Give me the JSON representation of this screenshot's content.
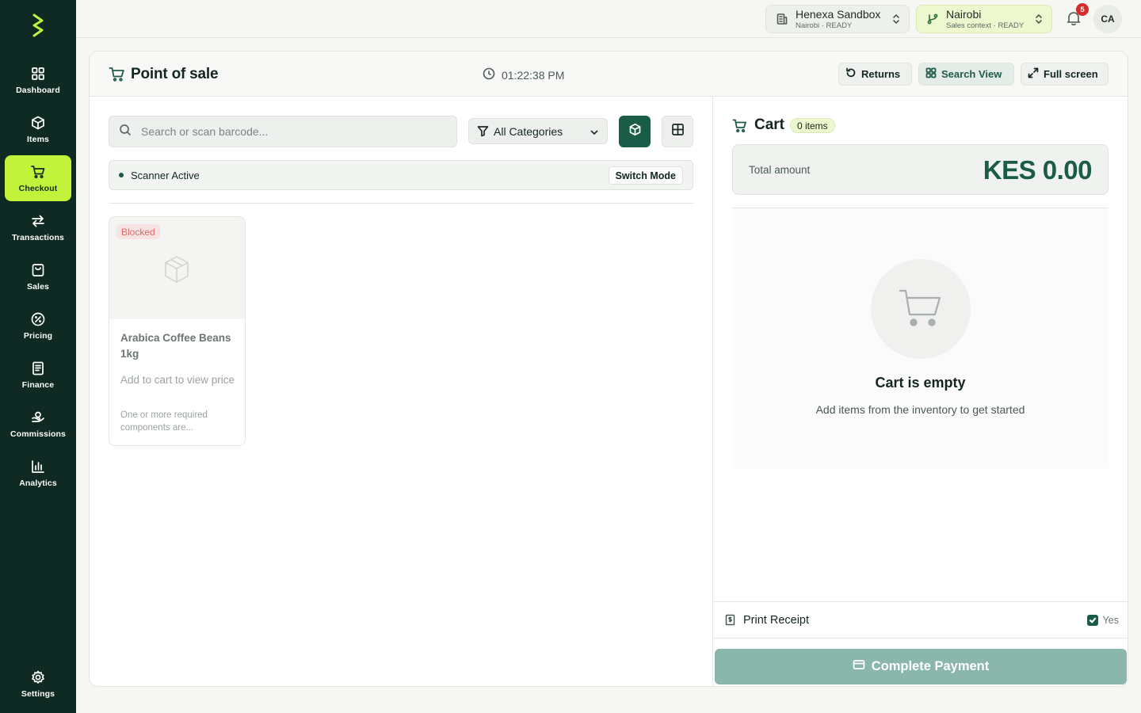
{
  "sidebar": {
    "logo_icon": "brand-logo-icon",
    "items": [
      {
        "label": "Dashboard",
        "icon": "dashboard-icon",
        "active": false
      },
      {
        "label": "Items",
        "icon": "box-icon",
        "active": false
      },
      {
        "label": "Checkout",
        "icon": "cart-icon",
        "active": true
      },
      {
        "label": "Transactions",
        "icon": "arrows-icon",
        "active": false
      },
      {
        "label": "Sales",
        "icon": "bag-icon",
        "active": false
      },
      {
        "label": "Pricing",
        "icon": "percent-icon",
        "active": false
      },
      {
        "label": "Finance",
        "icon": "document-icon",
        "active": false
      },
      {
        "label": "Commissions",
        "icon": "handshake-icon",
        "active": false
      },
      {
        "label": "Analytics",
        "icon": "bar-chart-icon",
        "active": false
      }
    ],
    "settings_label": "Settings"
  },
  "topbar": {
    "company": {
      "name": "Henexa Sandbox",
      "sub": "Nairobi · READY"
    },
    "branch": {
      "name": "Nairobi",
      "sub": "Sales context · READY"
    },
    "notifications_count": "5",
    "avatar_initials": "CA"
  },
  "header": {
    "title": "Point of sale",
    "time": "01:22:38 PM",
    "returns_label": "Returns",
    "search_view_label": "Search View",
    "full_screen_label": "Full screen"
  },
  "inventory": {
    "search_placeholder": "Search or scan barcode...",
    "category_selected": "All Categories",
    "scanner_status": "Scanner Active",
    "switch_mode_label": "Switch Mode",
    "products": [
      {
        "badge": "Blocked",
        "name": "Arabica Coffee Beans 1kg",
        "price_text": "Add to cart to view price",
        "note": "One or more required components are..."
      }
    ]
  },
  "cart": {
    "title": "Cart",
    "items_count_label": "0 items",
    "total_label": "Total amount",
    "total_value": "KES 0.00",
    "empty_title": "Cart is empty",
    "empty_sub": "Add items from the inventory to get started",
    "print_receipt_label": "Print Receipt",
    "print_receipt_checked": true,
    "print_receipt_value": "Yes",
    "complete_payment_label": "Complete Payment"
  },
  "colors": {
    "sidebar_bg": "#0e2a23",
    "accent_lime": "#c3f23a",
    "primary_green": "#1a5c48",
    "disabled_pay": "#8bb6ab",
    "badge_red": "#d62c2c"
  }
}
